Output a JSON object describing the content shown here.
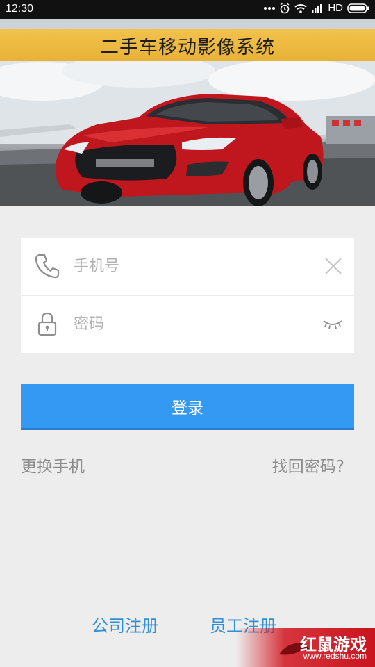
{
  "status_bar": {
    "time": "12:30",
    "network_label": "HD",
    "icons": [
      "more-dots-icon",
      "alarm-icon",
      "wifi-icon",
      "signal-icon",
      "battery-icon"
    ]
  },
  "banner": {
    "title": "二手车移动影像系统",
    "strip_color": "#f0bd45"
  },
  "login_form": {
    "phone": {
      "placeholder": "手机号",
      "value": "",
      "icon": "phone-icon",
      "action_icon": "clear-icon"
    },
    "password": {
      "placeholder": "密码",
      "value": "",
      "icon": "lock-icon",
      "action_icon": "eye-closed-icon"
    },
    "submit_label": "登录",
    "accent_color": "#3399f3"
  },
  "links": {
    "change_phone": "更换手机",
    "recover_password": "找回密码?"
  },
  "footer": {
    "company_register": "公司注册",
    "employee_register": "员工注册",
    "link_color": "#2f8fd8"
  },
  "watermark": {
    "brand": "红鼠游戏",
    "url": "www.redshu.com"
  }
}
